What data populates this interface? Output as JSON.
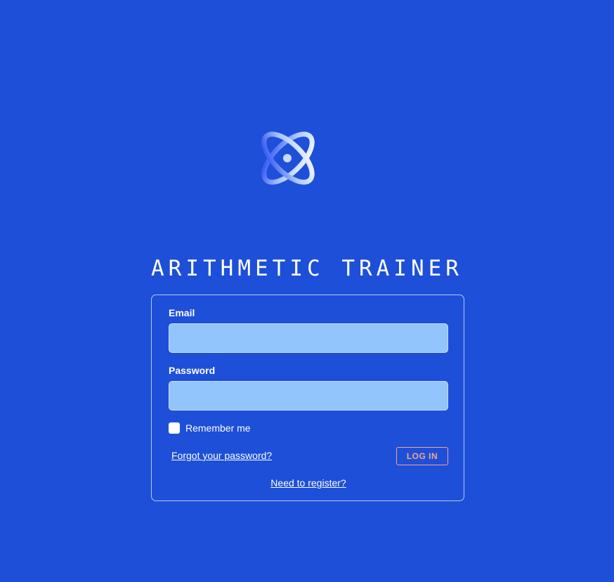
{
  "app": {
    "title": "ARITHMETIC TRAINER",
    "logo_icon": "orbit-atom-icon"
  },
  "login_form": {
    "email_label": "Email",
    "email_value": "",
    "password_label": "Password",
    "password_value": "",
    "remember_label": "Remember me",
    "remember_checked": false,
    "forgot_label": "Forgot your password?",
    "login_label": "LOG IN",
    "register_label": "Need to register?"
  },
  "colors": {
    "background": "#1d4fd8",
    "input_fill": "#93c5fd",
    "login_button_accent": "#f7a58a",
    "text": "#ffffff"
  }
}
